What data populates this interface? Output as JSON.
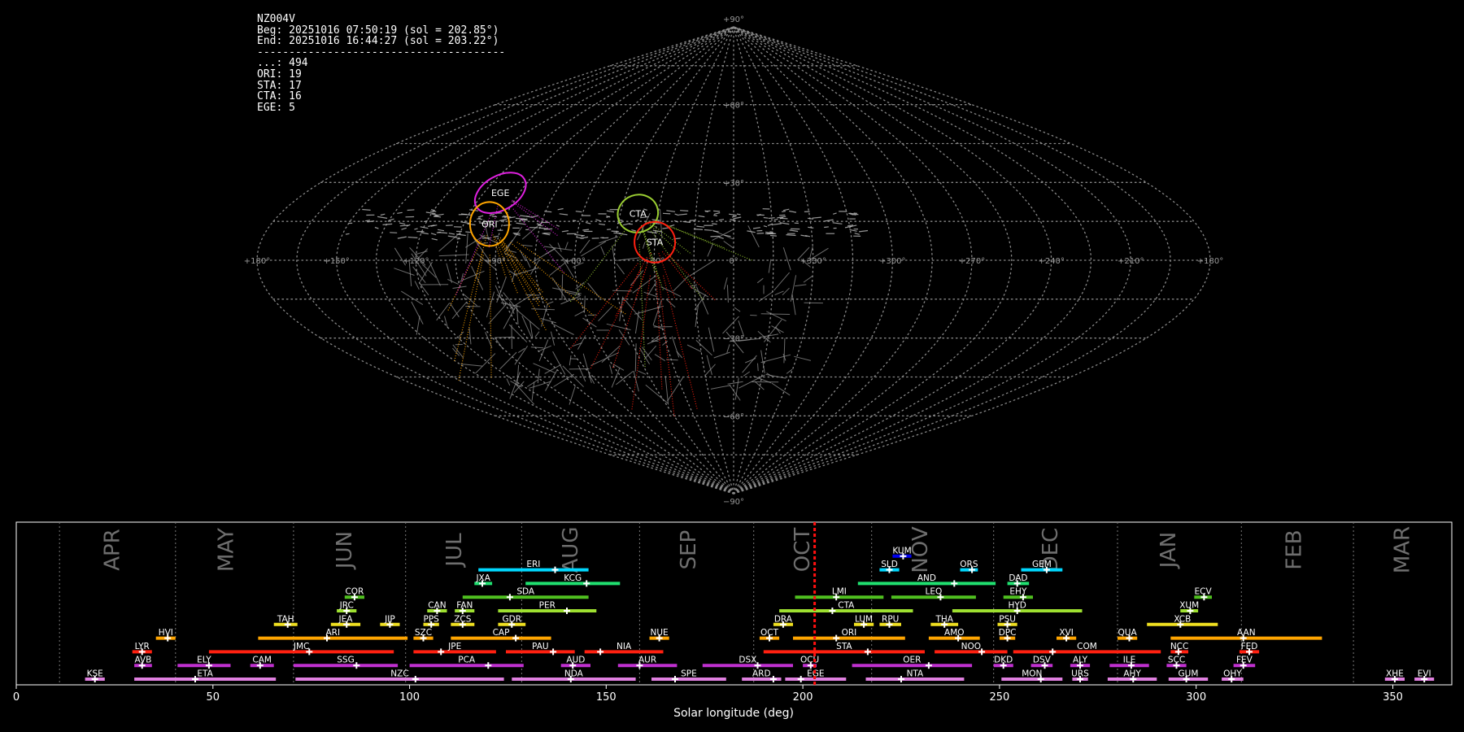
{
  "station": {
    "id": "NZ004V",
    "begin": "Beg: 20251016 07:50:19 (sol = 202.85°)",
    "end": "End: 20251016 16:44:27 (sol = 203.22°)",
    "separator": "---------------------------------------",
    "counts": [
      {
        "code": "...",
        "count": 494
      },
      {
        "code": "ORI",
        "count": 19
      },
      {
        "code": "STA",
        "count": 17
      },
      {
        "code": "CTA",
        "count": 16
      },
      {
        "code": "EGE",
        "count": 5
      }
    ]
  },
  "sky_map": {
    "projection": "sinusoidal",
    "lon_tick_labels": [
      "+180°",
      "+150°",
      "+120°",
      "+90°",
      "+60°",
      "+30°",
      "0°",
      "+330°",
      "+300°",
      "+270°",
      "+240°",
      "+210°",
      "+180°"
    ],
    "lat_tick_labels": [
      "+90°",
      "+60°",
      "+30°",
      "−30°",
      "−60°",
      "−90°"
    ],
    "radiants": [
      {
        "name": "EGE",
        "lon": 98,
        "lat": 26,
        "color": "#e020e0"
      },
      {
        "name": "ORI",
        "lon": 95,
        "lat": 14,
        "color": "#ffa500"
      },
      {
        "name": "CTA",
        "lon": 38,
        "lat": 18,
        "color": "#9acd32"
      },
      {
        "name": "STA",
        "lon": 30,
        "lat": 7,
        "color": "#ff2010"
      }
    ]
  },
  "chart_data": {
    "type": "timeline",
    "xlabel": "Solar longitude (deg)",
    "xlim": [
      0,
      365
    ],
    "xticks": [
      0,
      50,
      100,
      150,
      200,
      250,
      300,
      350
    ],
    "current_sol": 203.0,
    "months": [
      {
        "name": "APR",
        "sol": 24.5
      },
      {
        "name": "MAY",
        "sol": 53.5
      },
      {
        "name": "JUN",
        "sol": 83.5
      },
      {
        "name": "JUL",
        "sol": 111.5
      },
      {
        "name": "AUG",
        "sol": 141
      },
      {
        "name": "SEP",
        "sol": 171
      },
      {
        "name": "OCT",
        "sol": 200
      },
      {
        "name": "NOV",
        "sol": 230
      },
      {
        "name": "DEC",
        "sol": 263
      },
      {
        "name": "JAN",
        "sol": 293
      },
      {
        "name": "FEB",
        "sol": 325
      },
      {
        "name": "MAR",
        "sol": 352.5
      }
    ],
    "month_boundaries": [
      11,
      40.5,
      70.5,
      99,
      128.5,
      158.5,
      187.5,
      217.5,
      248.5,
      280,
      311.5,
      340
    ],
    "showers": [
      {
        "name": "KUM",
        "row": 9,
        "start": 222.8,
        "end": 227.6,
        "peak": 225.5,
        "color": "#0000ee"
      },
      {
        "name": "ERI",
        "row": 8,
        "start": 117.5,
        "end": 145.5,
        "peak": 137,
        "color": "#00d8ff"
      },
      {
        "name": "SLD",
        "row": 8,
        "start": 219.5,
        "end": 224.5,
        "peak": 222,
        "color": "#00d8ff"
      },
      {
        "name": "ORS",
        "row": 8,
        "start": 240,
        "end": 244.5,
        "peak": 243,
        "color": "#00d8ff"
      },
      {
        "name": "GEM",
        "row": 8,
        "start": 255.5,
        "end": 266,
        "peak": 262,
        "color": "#00d8ff"
      },
      {
        "name": "JXA",
        "row": 7,
        "start": 116.5,
        "end": 121,
        "peak": 118.5,
        "color": "#20e070"
      },
      {
        "name": "KCG",
        "row": 7,
        "start": 129.5,
        "end": 153.5,
        "peak": 145,
        "color": "#20e070"
      },
      {
        "name": "AND",
        "row": 7,
        "start": 214,
        "end": 249,
        "peak": 238.5,
        "color": "#20e070"
      },
      {
        "name": "DAD",
        "row": 7,
        "start": 252,
        "end": 257.5,
        "peak": 254.5,
        "color": "#20e070"
      },
      {
        "name": "COR",
        "row": 6,
        "start": 83.5,
        "end": 88.5,
        "peak": 86,
        "color": "#50c020"
      },
      {
        "name": "SDA",
        "row": 6,
        "start": 113.5,
        "end": 145.5,
        "peak": 125.5,
        "color": "#50c020"
      },
      {
        "name": "LMI",
        "row": 6,
        "start": 198,
        "end": 220.5,
        "peak": 208.5,
        "color": "#50c020"
      },
      {
        "name": "LEO",
        "row": 6,
        "start": 222.5,
        "end": 244,
        "peak": 235,
        "color": "#50c020"
      },
      {
        "name": "EHY",
        "row": 6,
        "start": 251,
        "end": 258.5,
        "peak": 256,
        "color": "#50c020"
      },
      {
        "name": "ECV",
        "row": 6,
        "start": 299.5,
        "end": 304,
        "peak": 302,
        "color": "#50c020"
      },
      {
        "name": "JRC",
        "row": 5,
        "start": 81.5,
        "end": 86.5,
        "peak": 84,
        "color": "#9ee030"
      },
      {
        "name": "CAN",
        "row": 5,
        "start": 104.5,
        "end": 109.5,
        "peak": 107,
        "color": "#9ee030"
      },
      {
        "name": "FAN",
        "row": 5,
        "start": 111.5,
        "end": 116.5,
        "peak": 113.5,
        "color": "#9ee030"
      },
      {
        "name": "PER",
        "row": 5,
        "start": 122.5,
        "end": 147.5,
        "peak": 140,
        "color": "#9ee030"
      },
      {
        "name": "CTA",
        "row": 5,
        "start": 194,
        "end": 228,
        "peak": 207.5,
        "color": "#9ee030"
      },
      {
        "name": "HYD",
        "row": 5,
        "start": 238,
        "end": 271,
        "peak": 254.5,
        "color": "#9ee030"
      },
      {
        "name": "XUM",
        "row": 5,
        "start": 296,
        "end": 300.5,
        "peak": 298.5,
        "color": "#9ee030"
      },
      {
        "name": "TAH",
        "row": 4,
        "start": 65.5,
        "end": 71.5,
        "peak": 69,
        "color": "#f0e020"
      },
      {
        "name": "JEA",
        "row": 4,
        "start": 80,
        "end": 87.5,
        "peak": 84,
        "color": "#f0e020"
      },
      {
        "name": "JIP",
        "row": 4,
        "start": 92.5,
        "end": 97.5,
        "peak": 95,
        "color": "#f0e020"
      },
      {
        "name": "PPS",
        "row": 4,
        "start": 103.5,
        "end": 107.5,
        "peak": 105.5,
        "color": "#f0e020"
      },
      {
        "name": "ZCS",
        "row": 4,
        "start": 110.5,
        "end": 116.5,
        "peak": 113.5,
        "color": "#f0e020"
      },
      {
        "name": "GDR",
        "row": 4,
        "start": 122.5,
        "end": 129.5,
        "peak": 126,
        "color": "#f0e020"
      },
      {
        "name": "DRA",
        "row": 4,
        "start": 192.5,
        "end": 197.5,
        "peak": 195,
        "color": "#f0e020"
      },
      {
        "name": "LUM",
        "row": 4,
        "start": 213,
        "end": 218,
        "peak": 215.5,
        "color": "#f0e020"
      },
      {
        "name": "RPU",
        "row": 4,
        "start": 219.5,
        "end": 225,
        "peak": 222,
        "color": "#f0e020"
      },
      {
        "name": "THA",
        "row": 4,
        "start": 232.5,
        "end": 239.5,
        "peak": 236,
        "color": "#f0e020"
      },
      {
        "name": "PSU",
        "row": 4,
        "start": 249.5,
        "end": 254.5,
        "peak": 252,
        "color": "#f0e020"
      },
      {
        "name": "XCB",
        "row": 4,
        "start": 287.5,
        "end": 305.5,
        "peak": 296,
        "color": "#f0e020"
      },
      {
        "name": "HVI",
        "row": 3,
        "start": 35.5,
        "end": 40.5,
        "peak": 38.5,
        "color": "#ffa500"
      },
      {
        "name": "ARI",
        "row": 3,
        "start": 61.5,
        "end": 99.5,
        "peak": 79,
        "color": "#ffa500"
      },
      {
        "name": "SZC",
        "row": 3,
        "start": 101,
        "end": 106,
        "peak": 103.5,
        "color": "#ffa500"
      },
      {
        "name": "CAP",
        "row": 3,
        "start": 110.5,
        "end": 136,
        "peak": 127,
        "color": "#ffa500"
      },
      {
        "name": "NUE",
        "row": 3,
        "start": 161,
        "end": 166,
        "peak": 163.5,
        "color": "#ffa500"
      },
      {
        "name": "OCT",
        "row": 3,
        "start": 189,
        "end": 194,
        "peak": 191.5,
        "color": "#ffa500"
      },
      {
        "name": "ORI",
        "row": 3,
        "start": 197.5,
        "end": 226,
        "peak": 208.5,
        "color": "#ffa500"
      },
      {
        "name": "AMO",
        "row": 3,
        "start": 232,
        "end": 245,
        "peak": 239.5,
        "color": "#ffa500"
      },
      {
        "name": "DPC",
        "row": 3,
        "start": 250,
        "end": 254,
        "peak": 252,
        "color": "#ffa500"
      },
      {
        "name": "XVI",
        "row": 3,
        "start": 264.5,
        "end": 269.5,
        "peak": 267,
        "color": "#ffa500"
      },
      {
        "name": "QUA",
        "row": 3,
        "start": 280,
        "end": 285,
        "peak": 283,
        "color": "#ffa500"
      },
      {
        "name": "AAN",
        "row": 3,
        "start": 293.5,
        "end": 332,
        "peak": 312,
        "color": "#ffa500"
      },
      {
        "name": "LYR",
        "row": 2,
        "start": 29.5,
        "end": 34.5,
        "peak": 32,
        "color": "#ff2010"
      },
      {
        "name": "JMC",
        "row": 2,
        "start": 49,
        "end": 96,
        "peak": 74.5,
        "color": "#ff2010"
      },
      {
        "name": "JPE",
        "row": 2,
        "start": 101,
        "end": 122,
        "peak": 108,
        "color": "#ff2010"
      },
      {
        "name": "PAU",
        "row": 2,
        "start": 124.5,
        "end": 142,
        "peak": 136.5,
        "color": "#ff2010"
      },
      {
        "name": "NIA",
        "row": 2,
        "start": 144.5,
        "end": 164.5,
        "peak": 148.5,
        "color": "#ff2010"
      },
      {
        "name": "STA",
        "row": 2,
        "start": 190,
        "end": 231,
        "peak": 216.5,
        "color": "#ff2010"
      },
      {
        "name": "NOO",
        "row": 2,
        "start": 233.5,
        "end": 252,
        "peak": 245.5,
        "color": "#ff2010"
      },
      {
        "name": "COM",
        "row": 2,
        "start": 253.5,
        "end": 291,
        "peak": 263.5,
        "color": "#ff2010"
      },
      {
        "name": "NCC",
        "row": 2,
        "start": 293.5,
        "end": 298,
        "peak": 295.5,
        "color": "#ff2010"
      },
      {
        "name": "FED",
        "row": 2,
        "start": 311,
        "end": 316,
        "peak": 313.5,
        "color": "#ff2010"
      },
      {
        "name": "AVB",
        "row": 1,
        "start": 30,
        "end": 34.5,
        "peak": 32,
        "color": "#c030d0"
      },
      {
        "name": "ELY",
        "row": 1,
        "start": 41,
        "end": 54.5,
        "peak": 49,
        "color": "#c030d0"
      },
      {
        "name": "CAM",
        "row": 1,
        "start": 59.5,
        "end": 65.5,
        "peak": 62,
        "color": "#c030d0"
      },
      {
        "name": "SSG",
        "row": 1,
        "start": 70.5,
        "end": 97,
        "peak": 86.5,
        "color": "#c030d0"
      },
      {
        "name": "PCA",
        "row": 1,
        "start": 100,
        "end": 129,
        "peak": 120,
        "color": "#c030d0"
      },
      {
        "name": "AUD",
        "row": 1,
        "start": 138.5,
        "end": 146,
        "peak": 141.5,
        "color": "#c030d0"
      },
      {
        "name": "AUR",
        "row": 1,
        "start": 153,
        "end": 168,
        "peak": 158.5,
        "color": "#c030d0"
      },
      {
        "name": "DSX",
        "row": 1,
        "start": 174.5,
        "end": 197.5,
        "peak": 188.5,
        "color": "#c030d0"
      },
      {
        "name": "OCU",
        "row": 1,
        "start": 200,
        "end": 203.5,
        "peak": 202,
        "color": "#c030d0"
      },
      {
        "name": "OER",
        "row": 1,
        "start": 212.5,
        "end": 243,
        "peak": 232,
        "color": "#c030d0"
      },
      {
        "name": "DKD",
        "row": 1,
        "start": 248.5,
        "end": 253.5,
        "peak": 251,
        "color": "#c030d0"
      },
      {
        "name": "DSV",
        "row": 1,
        "start": 258,
        "end": 263.5,
        "peak": 261.5,
        "color": "#c030d0"
      },
      {
        "name": "ALY",
        "row": 1,
        "start": 268,
        "end": 273,
        "peak": 270.5,
        "color": "#c030d0"
      },
      {
        "name": "ILE",
        "row": 1,
        "start": 278,
        "end": 288,
        "peak": 283.5,
        "color": "#c030d0"
      },
      {
        "name": "SCC",
        "row": 1,
        "start": 292.5,
        "end": 297.5,
        "peak": 295,
        "color": "#c030d0"
      },
      {
        "name": "FEV",
        "row": 1,
        "start": 309.5,
        "end": 315,
        "peak": 312,
        "color": "#c030d0"
      },
      {
        "name": "KSE",
        "row": 0,
        "start": 17.5,
        "end": 22.5,
        "peak": 20,
        "color": "#e080e0"
      },
      {
        "name": "ETA",
        "row": 0,
        "start": 30,
        "end": 66,
        "peak": 45.5,
        "color": "#e080e0"
      },
      {
        "name": "NZC",
        "row": 0,
        "start": 71,
        "end": 124,
        "peak": 101.5,
        "color": "#e080e0"
      },
      {
        "name": "NDA",
        "row": 0,
        "start": 126,
        "end": 157.5,
        "peak": 141,
        "color": "#e080e0"
      },
      {
        "name": "SPE",
        "row": 0,
        "start": 161.5,
        "end": 180.5,
        "peak": 167.5,
        "color": "#e080e0"
      },
      {
        "name": "ARD",
        "row": 0,
        "start": 184.5,
        "end": 194.5,
        "peak": 192.5,
        "color": "#e080e0"
      },
      {
        "name": "EGE",
        "row": 0,
        "start": 195.5,
        "end": 211,
        "peak": 199.5,
        "color": "#e080e0"
      },
      {
        "name": "NTA",
        "row": 0,
        "start": 216,
        "end": 241,
        "peak": 225,
        "color": "#e080e0"
      },
      {
        "name": "MON",
        "row": 0,
        "start": 250.5,
        "end": 266,
        "peak": 260.5,
        "color": "#e080e0"
      },
      {
        "name": "URS",
        "row": 0,
        "start": 268.5,
        "end": 272.5,
        "peak": 270.5,
        "color": "#e080e0"
      },
      {
        "name": "AHY",
        "row": 0,
        "start": 277.5,
        "end": 290,
        "peak": 284,
        "color": "#e080e0"
      },
      {
        "name": "GUM",
        "row": 0,
        "start": 293,
        "end": 303,
        "peak": 297.5,
        "color": "#e080e0"
      },
      {
        "name": "OHY",
        "row": 0,
        "start": 306.5,
        "end": 312,
        "peak": 309,
        "color": "#e080e0"
      },
      {
        "name": "XHE",
        "row": 0,
        "start": 348,
        "end": 353,
        "peak": 350.5,
        "color": "#e080e0"
      },
      {
        "name": "EVI",
        "row": 0,
        "start": 355.5,
        "end": 360.5,
        "peak": 358,
        "color": "#e080e0"
      }
    ]
  }
}
